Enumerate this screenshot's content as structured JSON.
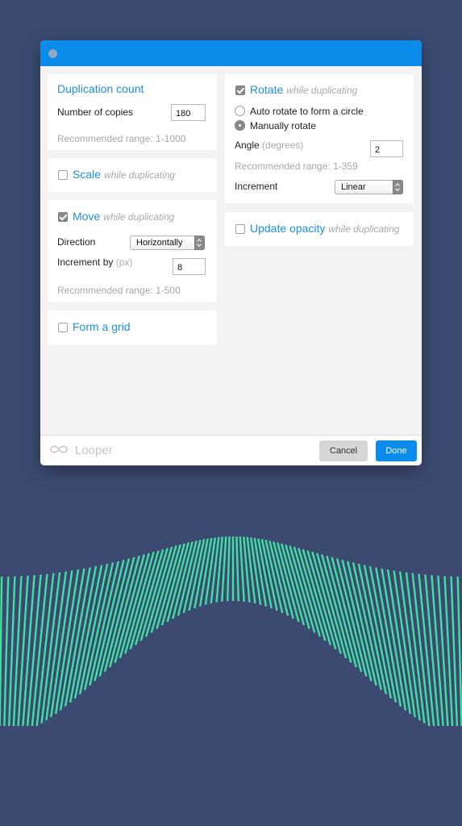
{
  "app": {
    "name": "Looper"
  },
  "duplication": {
    "title": "Duplication count",
    "copies_label": "Number of copies",
    "copies_value": "180",
    "range": "Recommended range: 1-1000"
  },
  "scale": {
    "title": "Scale",
    "hint": "while duplicating",
    "checked": false
  },
  "move": {
    "title": "Move",
    "hint": "while duplicating",
    "checked": true,
    "direction_label": "Direction",
    "direction_value": "Horizontally",
    "increment_label": "Increment by",
    "increment_unit": "(px)",
    "increment_value": "8",
    "range": "Recommended range: 1-500"
  },
  "grid": {
    "title": "Form a grid",
    "checked": false
  },
  "rotate": {
    "title": "Rotate",
    "hint": "while duplicating",
    "checked": true,
    "option_auto": "Auto rotate to form a circle",
    "option_manual": "Manually rotate",
    "selected_option": "manual",
    "angle_label": "Angle",
    "angle_unit": "(degrees)",
    "angle_value": "2",
    "range": "Recommended range: 1-359",
    "increment_label": "Increment",
    "increment_value": "Linear"
  },
  "opacity": {
    "title": "Update opacity",
    "hint": "while duplicating",
    "checked": false
  },
  "footer": {
    "logo_text": "Looper",
    "cancel_label": "Cancel",
    "done_label": "Done"
  },
  "colors": {
    "background": "#3c4a72",
    "accent": "#0b8ceb",
    "link": "#1d8fe0",
    "wave": "#3fe0a0"
  }
}
